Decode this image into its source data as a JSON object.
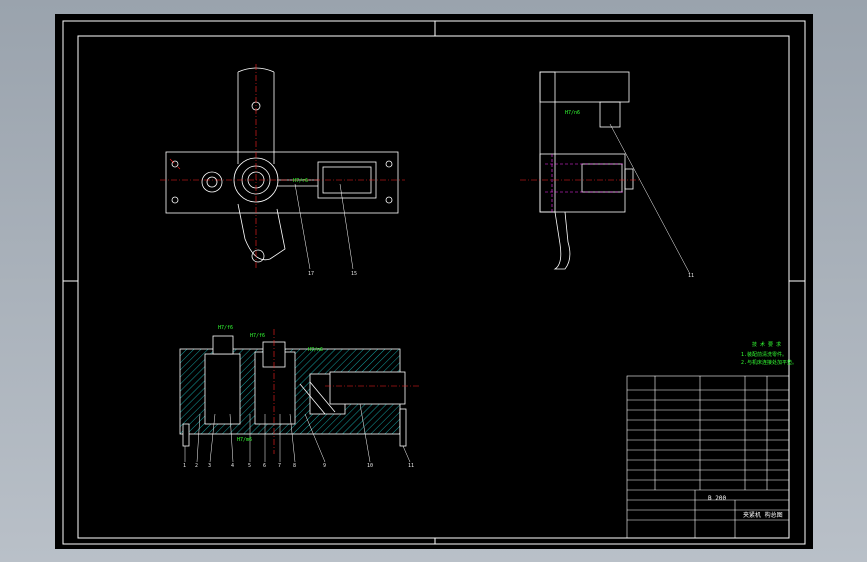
{
  "drawing": {
    "title_code": "B 200",
    "title_name": "夹紧机 构总图",
    "tech_req_heading": "技 术 要 求",
    "tech_req_lines": [
      "1.装配前清洗零件。",
      "2.与机床连接处加平垫。"
    ],
    "balloons_plan": [
      "17",
      "15"
    ],
    "balloons_side": [
      "11"
    ],
    "balloons_section": [
      "1",
      "2",
      "3",
      "4",
      "5",
      "6",
      "7",
      "8",
      "9",
      "10",
      "11"
    ],
    "section_labels": [
      "H7/f6",
      "H7/f6",
      "H7/n6",
      "H7/m6",
      "H7/n6",
      "H7/r6"
    ]
  },
  "colors": {
    "background": "#000000",
    "outline": "#ffffff",
    "center_line": "#ff2020",
    "dimension": "#33ff33",
    "hidden": "#ff33ff"
  }
}
